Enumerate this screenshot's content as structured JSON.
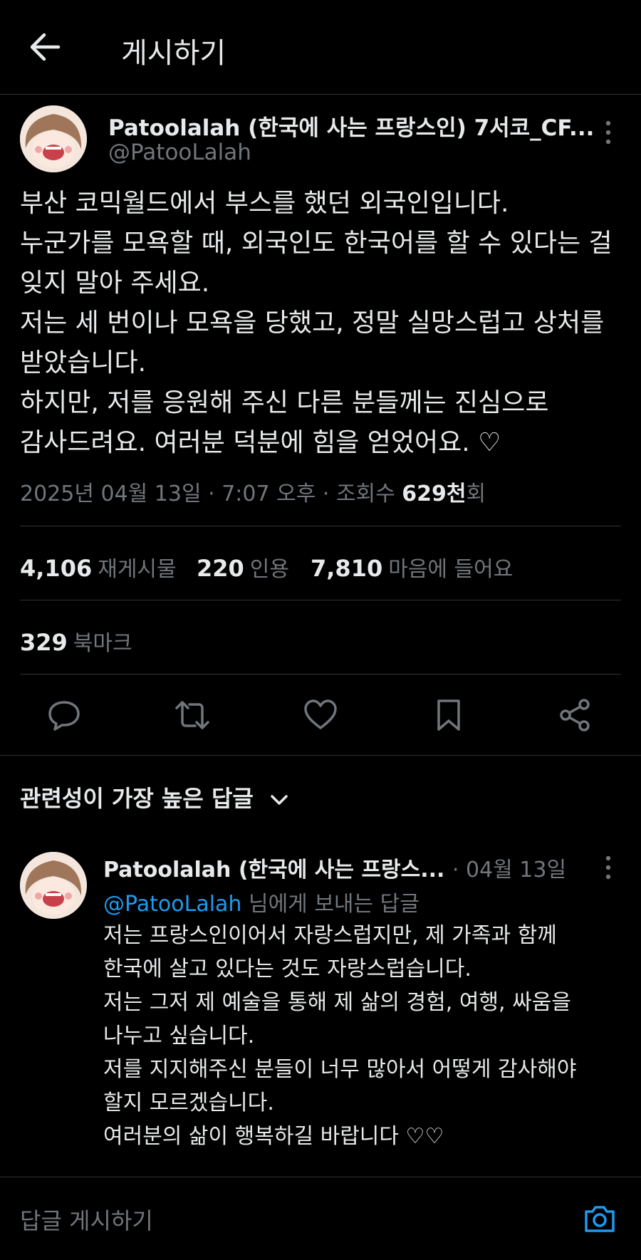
{
  "header": {
    "title": "게시하기",
    "back_icon": "arrow-left-icon"
  },
  "post": {
    "author_name": "Patoolalah (한국에 사는 프랑스인) 7서코_CF...",
    "handle": "@PatooLalah",
    "lines": [
      "부산 코믹월드에서 부스를 했던 외국인입니다.",
      "누군가를 모욕할 때, 외국인도 한국어를 할 수 있다는 걸",
      "잊지 말아 주세요.",
      "저는 세 번이나 모욕을 당했고, 정말 실망스럽고 상처를",
      "받았습니다.",
      "하지만, 저를 응원해 주신 다른 분들께는 진심으로",
      "감사드려요. 여러분 덕분에 힘을 얻었어요. ♡"
    ],
    "date": "2025년 04월 13일",
    "time": "7:07 오후",
    "views_label": "조회수",
    "views_count": "629천",
    "views_suffix": "회"
  },
  "stats": {
    "reposts": {
      "value": "4,106",
      "label": "재게시물"
    },
    "quotes": {
      "value": "220",
      "label": "인용"
    },
    "likes": {
      "value": "7,810",
      "label": "마음에 들어요"
    },
    "bookmarks": {
      "value": "329",
      "label": "북마크"
    }
  },
  "actions": [
    "reply-icon",
    "repost-icon",
    "like-icon",
    "bookmark-icon",
    "share-icon"
  ],
  "replies_sort": {
    "label": "관련성이 가장 높은 답글"
  },
  "reply": {
    "author_name": "Patoolalah (한국에 사는 프랑스...",
    "date": "· 04월 13일",
    "replying_to_handle": "@PatooLalah",
    "replying_to_suffix": "님에게 보내는 답글",
    "lines": [
      "저는 프랑스인이어서 자랑스럽지만, 제 가족과 함께",
      "한국에 살고 있다는 것도 자랑스럽습니다.",
      "저는 그저 제 예술을 통해 제 삶의 경험, 여행, 싸움을",
      "나누고 싶습니다.",
      "저를 지지해주신 분들이 너무 많아서 어떻게 감사해야",
      "할지 모르겠습니다.",
      "여러분의 삶이 행복하길 바랍니다 ♡♡"
    ]
  },
  "composer": {
    "placeholder": "답글 게시하기"
  },
  "colors": {
    "background": "#000000",
    "text": "#e7e9ea",
    "muted": "#71767b",
    "accent": "#1d9bf0",
    "border": "#2f3336"
  }
}
